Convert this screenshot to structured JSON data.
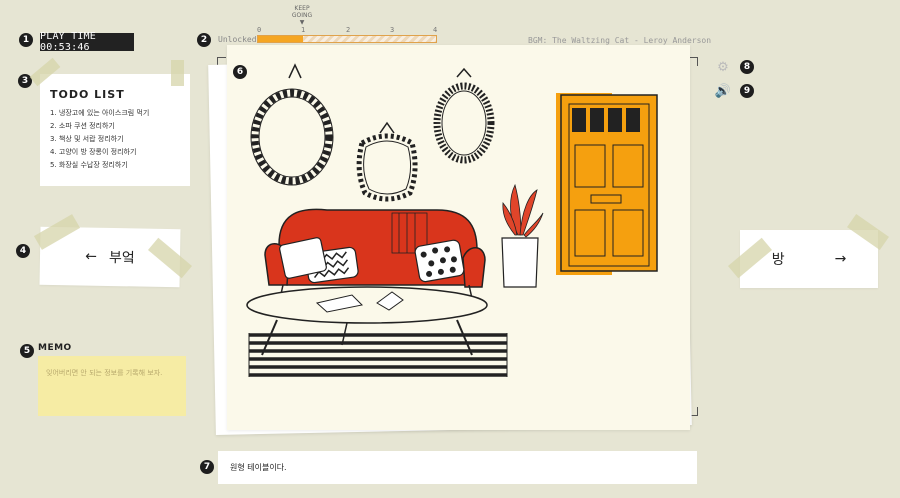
{
  "hud": {
    "playtime_label": "PLAY TIME 00:53:46",
    "unlocked_label": "Unlocked",
    "progress_fraction": 0.25,
    "progress_ticks": [
      "0",
      "1",
      "2",
      "3",
      "4"
    ],
    "keep_going": "KEEP GOING",
    "bgm": "BGM: The Waltzing Cat - Leroy Anderson"
  },
  "markers": [
    "1",
    "2",
    "3",
    "4",
    "5",
    "6",
    "7",
    "8",
    "9"
  ],
  "todo": {
    "title": "TODO LIST",
    "items": [
      "1. 냉장고에 있는 아이스크림 먹기",
      "2. 소파 쿠션 정리하기",
      "3. 책상 및 서랍 정리하기",
      "4. 고양이 방 장롱이 정리하기",
      "5. 화장실 수납장 정리하기"
    ]
  },
  "nav": {
    "left_label": "부엌",
    "right_label": "방",
    "left_arrow": "←",
    "right_arrow": "→"
  },
  "memo": {
    "title": "MEMO",
    "placeholder": "잊어버리면 안 되는 정보를 기록해 보자."
  },
  "message": "원형 테이블이다.",
  "icons": [
    "settings-gear-icon",
    "sound-speaker-icon"
  ],
  "colors": {
    "sofa": "#d9351c",
    "door": "#f5a00f",
    "accent": "#f5a623",
    "memo": "#f6eca4"
  }
}
